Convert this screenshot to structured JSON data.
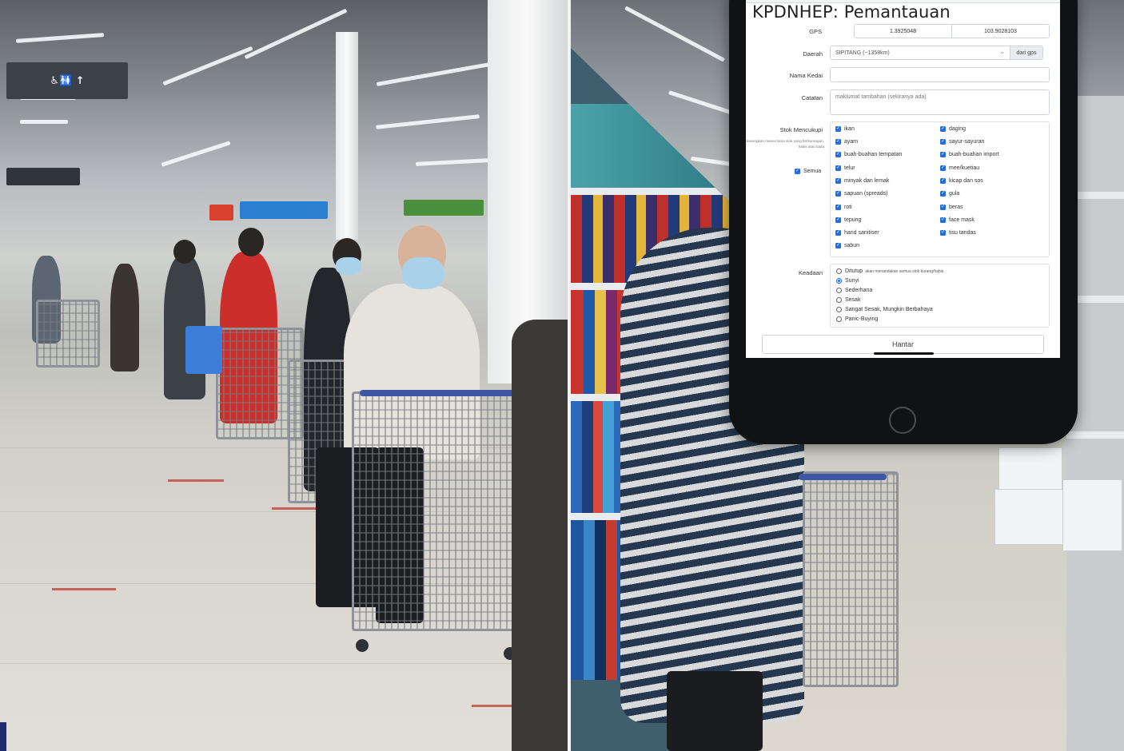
{
  "background": {
    "sign_text": "♿🚻 ↑"
  },
  "app": {
    "title": "KPDNHEP: Pemantauan"
  },
  "gps": {
    "label": "GPS",
    "latitude": "1.3925048",
    "longitude": "103.9028103"
  },
  "daerah": {
    "label": "Daerah",
    "value": "SIPITANG (~1358km)",
    "button": "dari gps"
  },
  "nama_kedai": {
    "label": "Nama Kedai",
    "value": ""
  },
  "catatan": {
    "label": "Catatan",
    "placeholder": "maklumat tambahan (sekiranya ada)"
  },
  "stok": {
    "label": "Stok Mencukupi",
    "hint": "kosongkan mana-mana stok yang berkurangan, habis atau tiada",
    "semua": "Semua",
    "items": [
      "ikan",
      "daging",
      "ayam",
      "sayur-sayuran",
      "buah-buahan tempatan",
      "buah-buahan import",
      "telur",
      "mee/kuetiau",
      "minyak dan lemak",
      "kicap dan sos",
      "sapuan (spreads)",
      "gula",
      "roti",
      "beras",
      "tepung",
      "face mask",
      "hand sanitiser",
      "tisu tandas",
      "sabun"
    ]
  },
  "keadaan": {
    "label": "Keadaan",
    "note": "akan menandakan semua stok kurang/habis",
    "options": [
      "Ditutup",
      "Sunyi",
      "Sederhana",
      "Sesak",
      "Sangat Sesak, Mungkin Berbahaya",
      "Panic-Buying"
    ],
    "selected": "Sunyi"
  },
  "submit": {
    "label": "Hantar"
  }
}
